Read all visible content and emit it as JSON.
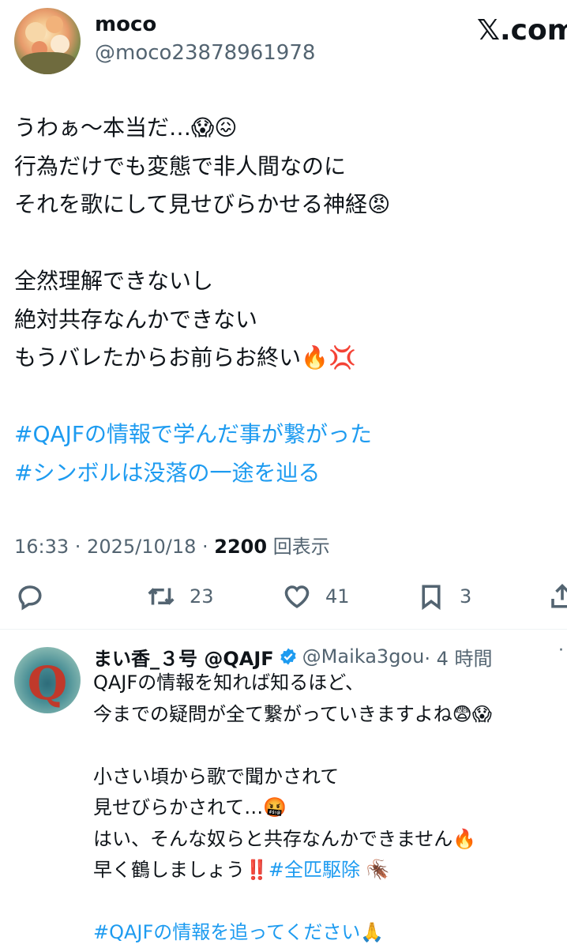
{
  "header": {
    "display_name": "moco",
    "handle": "@moco23878961978",
    "brand": "𝕏.com"
  },
  "tweet": {
    "lines": [
      "うわぁ〜本当だ…😱😖",
      "行為だけでも変態で非人間なのに",
      "それを歌にして見せびらかせる神経😡",
      "",
      "全然理解できないし",
      "絶対共存なんかできない",
      "もうバレたからお前らお終い🔥💢",
      ""
    ],
    "hashtags": [
      "#QAJFの情報で学んだ事が繋がった",
      "#シンボルは没落の一途を辿る"
    ],
    "time": "16:33 · 2025/10/18 · ",
    "views_count": "2200",
    "views_label": " 回表示"
  },
  "actions": {
    "reply_icon": "reply-icon",
    "retweet_icon": "retweet-icon",
    "retweet_count": "23",
    "like_icon": "heart-icon",
    "like_count": "41",
    "bookmark_icon": "bookmark-icon",
    "bookmark_count": "3",
    "share_icon": "share-icon"
  },
  "reply": {
    "display_name": "まい香_３号 @QAJF",
    "handle": "@Maika3gou",
    "time": "· 4 時間",
    "more": "·",
    "line_1": "QAJFの情報を知れば知るほど、",
    "line_2": "今までの疑問が全て繋がっていきますよね😨😱",
    "line_4": "小さい頃から歌で聞かされて",
    "line_5": "見せびらかされて…🤬",
    "line_6": "はい、そんな奴らと共存なんかできません🔥",
    "line_7_text": "早く鶴しましょう‼️",
    "line_7_tag": "#全匹駆除",
    "line_7_emoji": " 🪳",
    "line_9_tag": "#QAJFの情報を追ってください",
    "line_9_emoji": "🙏"
  },
  "colors": {
    "link": "#1d9bf0",
    "secondary": "#536471",
    "verified": "#1d9bf0"
  }
}
